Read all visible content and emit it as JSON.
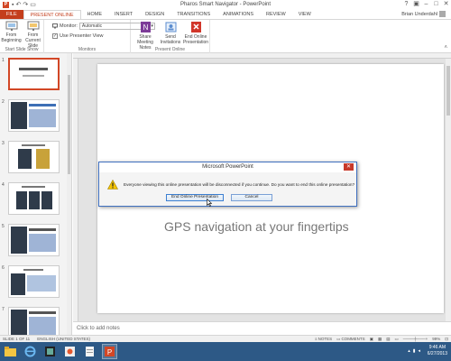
{
  "window": {
    "title": "Pharos Smart Navigator - PowerPoint",
    "app_icon": "powerpoint-icon",
    "qat": [
      "save-icon",
      "undo-icon",
      "redo-icon",
      "start-from-beginning-icon"
    ],
    "controls": [
      "?",
      "▣",
      "–",
      "□",
      "✕"
    ]
  },
  "tabs": [
    "FILE",
    "PRESENT ONLINE",
    "HOME",
    "INSERT",
    "DESIGN",
    "TRANSITIONS",
    "ANIMATIONS",
    "REVIEW",
    "VIEW"
  ],
  "active_tab": "PRESENT ONLINE",
  "user": {
    "name": "Brian Underdahl"
  },
  "ribbon": {
    "start_slide_show": {
      "label": "Start Slide Show",
      "from_beginning": "From Beginning",
      "from_current": "From Current Slide"
    },
    "monitors": {
      "label": "Monitors",
      "monitor_label": "Monitor:",
      "monitor_value": "Automatic",
      "presenter_view": "Use Presenter View",
      "presenter_view_checked": true
    },
    "present_online": {
      "label": "Present Online",
      "share_notes": "Share Meeting Notes",
      "send_invitations": "Send Invitations",
      "end_presentation": "End Online Presentation"
    }
  },
  "thumbnails": [
    "1",
    "2",
    "3",
    "4",
    "5",
    "6",
    "7"
  ],
  "slide": {
    "subtitle": "GPS navigation at your fingertips"
  },
  "notes_placeholder": "Click to add notes",
  "status": {
    "slide": "SLIDE 1 OF 11",
    "language": "ENGLISH (UNITED STATES)",
    "notes": "NOTES",
    "comments": "COMMENTS",
    "zoom": "99%"
  },
  "dialog": {
    "title": "Microsoft PowerPoint",
    "message": "Everyone viewing this online presentation will be disconnected if you continue. Do you want to end this online presentation?",
    "primary": "End Online Presentation",
    "cancel": "Cancel"
  },
  "taskbar": {
    "time": "9:46 AM",
    "date": "6/27/2013"
  }
}
